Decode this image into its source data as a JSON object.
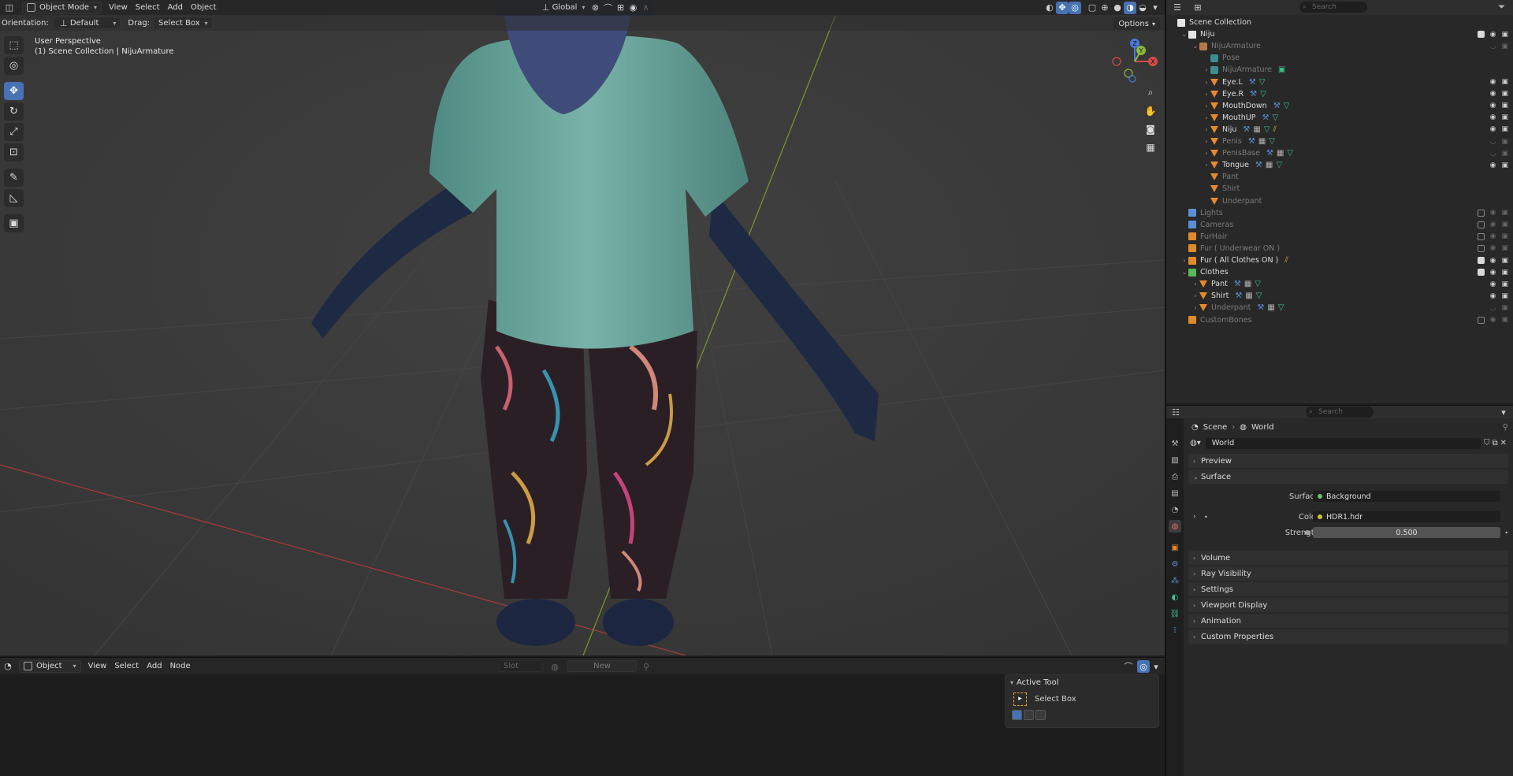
{
  "viewport_header": {
    "mode": "Object Mode",
    "menus": [
      "View",
      "Select",
      "Add",
      "Object"
    ],
    "transform_orientation": "Global",
    "orientation_label": "Orientation:",
    "orientation_value": "Default",
    "drag_label": "Drag:",
    "drag_value": "Select Box",
    "options": "Options"
  },
  "viewport_info": {
    "line1": "User Perspective",
    "line2": "(1) Scene Collection | NijuArmature"
  },
  "gizmo": {
    "x": "X",
    "y": "Y",
    "z": "Z"
  },
  "shader_header": {
    "mode": "Object",
    "menus": [
      "View",
      "Select",
      "Add",
      "Node"
    ],
    "slot": "Slot",
    "new": "New"
  },
  "active_tool": {
    "title": "Active Tool",
    "tool": "Select Box"
  },
  "outliner": {
    "search_placeholder": "Search",
    "rows": [
      {
        "label": "Scene Collection",
        "indent": 0,
        "icon": "collection-white",
        "exp": "",
        "dim": false,
        "vis": "none",
        "mods": []
      },
      {
        "label": "Niju",
        "indent": 1,
        "icon": "collection-white",
        "exp": "v",
        "dim": false,
        "vis": "full",
        "mods": []
      },
      {
        "label": "NijuArmature",
        "indent": 2,
        "icon": "armature",
        "exp": "v",
        "dim": true,
        "vis": "hidden",
        "mods": []
      },
      {
        "label": "Pose",
        "indent": 3,
        "icon": "pose",
        "exp": "",
        "dim": true,
        "vis": "none",
        "mods": []
      },
      {
        "label": "NijuArmature",
        "indent": 3,
        "icon": "pose",
        "exp": ">",
        "dim": true,
        "vis": "none",
        "mods": [
          "bone-group"
        ]
      },
      {
        "label": "Eye.L",
        "indent": 3,
        "icon": "mesh",
        "exp": ">",
        "dim": false,
        "vis": "eyecam",
        "mods": [
          "wrench",
          "tri"
        ]
      },
      {
        "label": "Eye.R",
        "indent": 3,
        "icon": "mesh",
        "exp": ">",
        "dim": false,
        "vis": "eyecam",
        "mods": [
          "wrench",
          "tri"
        ]
      },
      {
        "label": "MouthDown",
        "indent": 3,
        "icon": "mesh",
        "exp": ">",
        "dim": false,
        "vis": "eyecam",
        "mods": [
          "wrench",
          "tri"
        ]
      },
      {
        "label": "MouthUP",
        "indent": 3,
        "icon": "mesh",
        "exp": ">",
        "dim": false,
        "vis": "eyecam",
        "mods": [
          "wrench",
          "tri"
        ]
      },
      {
        "label": "Niju",
        "indent": 3,
        "icon": "mesh",
        "exp": ">",
        "dim": false,
        "vis": "eyecam",
        "mods": [
          "wrench",
          "grid",
          "tri",
          "hair"
        ]
      },
      {
        "label": "Penis",
        "indent": 3,
        "icon": "mesh",
        "exp": ">",
        "dim": true,
        "vis": "hidden",
        "mods": [
          "wrench",
          "grid",
          "tri"
        ]
      },
      {
        "label": "PenisBase",
        "indent": 3,
        "icon": "mesh",
        "exp": ">",
        "dim": true,
        "vis": "hidden",
        "mods": [
          "wrench",
          "grid",
          "tri"
        ]
      },
      {
        "label": "Tongue",
        "indent": 3,
        "icon": "mesh",
        "exp": ">",
        "dim": false,
        "vis": "eyecam",
        "mods": [
          "wrench",
          "grid",
          "tri"
        ]
      },
      {
        "label": "Pant",
        "indent": 3,
        "icon": "mesh",
        "exp": "",
        "dim": true,
        "vis": "none",
        "mods": []
      },
      {
        "label": "Shirt",
        "indent": 3,
        "icon": "mesh",
        "exp": "",
        "dim": true,
        "vis": "none",
        "mods": []
      },
      {
        "label": "Underpant",
        "indent": 3,
        "icon": "mesh",
        "exp": "",
        "dim": true,
        "vis": "none",
        "mods": []
      },
      {
        "label": "Lights",
        "indent": 1,
        "icon": "collection-blue",
        "exp": "",
        "dim": true,
        "vis": "unchecked",
        "mods": []
      },
      {
        "label": "Cameras",
        "indent": 1,
        "icon": "collection-blue",
        "exp": "",
        "dim": true,
        "vis": "unchecked",
        "mods": []
      },
      {
        "label": "FurHair",
        "indent": 1,
        "icon": "collection-orange",
        "exp": "",
        "dim": true,
        "vis": "unchecked",
        "mods": []
      },
      {
        "label": "Fur ( Underwear ON )",
        "indent": 1,
        "icon": "collection-orange",
        "exp": "",
        "dim": true,
        "vis": "unchecked",
        "mods": []
      },
      {
        "label": "Fur ( All Clothes ON )",
        "indent": 1,
        "icon": "collection-orange",
        "exp": ">",
        "dim": false,
        "vis": "full",
        "mods": [
          "hair"
        ]
      },
      {
        "label": "Clothes",
        "indent": 1,
        "icon": "collection-green",
        "exp": "v",
        "dim": false,
        "vis": "full",
        "mods": []
      },
      {
        "label": "Pant",
        "indent": 2,
        "icon": "mesh",
        "exp": ">",
        "dim": false,
        "vis": "eyecam",
        "mods": [
          "wrench",
          "grid",
          "tri"
        ]
      },
      {
        "label": "Shirt",
        "indent": 2,
        "icon": "mesh",
        "exp": ">",
        "dim": false,
        "vis": "eyecam",
        "mods": [
          "wrench",
          "grid",
          "tri"
        ]
      },
      {
        "label": "Underpant",
        "indent": 2,
        "icon": "mesh",
        "exp": ">",
        "dim": true,
        "vis": "hidden",
        "mods": [
          "wrench",
          "grid",
          "tri"
        ]
      },
      {
        "label": "CustomBones",
        "indent": 1,
        "icon": "collection-orange",
        "exp": "",
        "dim": true,
        "vis": "unchecked",
        "mods": []
      }
    ]
  },
  "properties": {
    "search_placeholder": "Search",
    "breadcrumb_scene": "Scene",
    "breadcrumb_world": "World",
    "world_name": "World",
    "panels_top": [
      "Preview",
      "Surface"
    ],
    "surface_label": "Surface",
    "surface_value": "Background",
    "color_label": "Color",
    "color_value": "HDR1.hdr",
    "strength_label": "Strength",
    "strength_value": "0.500",
    "panels_bottom": [
      "Volume",
      "Ray Visibility",
      "Settings",
      "Viewport Display",
      "Animation",
      "Custom Properties"
    ]
  },
  "colors": {
    "accent": "#4772b3",
    "shirt": "#6aa39a",
    "fur": "#1f2b44",
    "x_axis": "#a83a3a",
    "y_axis": "#7a9a2a"
  }
}
